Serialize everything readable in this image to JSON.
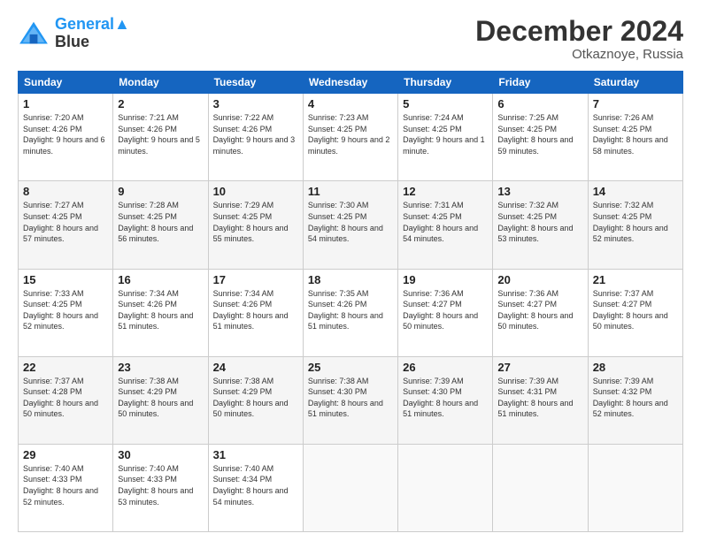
{
  "header": {
    "logo_line1": "General",
    "logo_line2": "Blue",
    "month": "December 2024",
    "location": "Otkaznoye, Russia"
  },
  "days_of_week": [
    "Sunday",
    "Monday",
    "Tuesday",
    "Wednesday",
    "Thursday",
    "Friday",
    "Saturday"
  ],
  "weeks": [
    [
      {
        "day": "1",
        "sunrise": "7:20 AM",
        "sunset": "4:26 PM",
        "daylight": "9 hours and 6 minutes."
      },
      {
        "day": "2",
        "sunrise": "7:21 AM",
        "sunset": "4:26 PM",
        "daylight": "9 hours and 5 minutes."
      },
      {
        "day": "3",
        "sunrise": "7:22 AM",
        "sunset": "4:26 PM",
        "daylight": "9 hours and 3 minutes."
      },
      {
        "day": "4",
        "sunrise": "7:23 AM",
        "sunset": "4:25 PM",
        "daylight": "9 hours and 2 minutes."
      },
      {
        "day": "5",
        "sunrise": "7:24 AM",
        "sunset": "4:25 PM",
        "daylight": "9 hours and 1 minute."
      },
      {
        "day": "6",
        "sunrise": "7:25 AM",
        "sunset": "4:25 PM",
        "daylight": "8 hours and 59 minutes."
      },
      {
        "day": "7",
        "sunrise": "7:26 AM",
        "sunset": "4:25 PM",
        "daylight": "8 hours and 58 minutes."
      }
    ],
    [
      {
        "day": "8",
        "sunrise": "7:27 AM",
        "sunset": "4:25 PM",
        "daylight": "8 hours and 57 minutes."
      },
      {
        "day": "9",
        "sunrise": "7:28 AM",
        "sunset": "4:25 PM",
        "daylight": "8 hours and 56 minutes."
      },
      {
        "day": "10",
        "sunrise": "7:29 AM",
        "sunset": "4:25 PM",
        "daylight": "8 hours and 55 minutes."
      },
      {
        "day": "11",
        "sunrise": "7:30 AM",
        "sunset": "4:25 PM",
        "daylight": "8 hours and 54 minutes."
      },
      {
        "day": "12",
        "sunrise": "7:31 AM",
        "sunset": "4:25 PM",
        "daylight": "8 hours and 54 minutes."
      },
      {
        "day": "13",
        "sunrise": "7:32 AM",
        "sunset": "4:25 PM",
        "daylight": "8 hours and 53 minutes."
      },
      {
        "day": "14",
        "sunrise": "7:32 AM",
        "sunset": "4:25 PM",
        "daylight": "8 hours and 52 minutes."
      }
    ],
    [
      {
        "day": "15",
        "sunrise": "7:33 AM",
        "sunset": "4:25 PM",
        "daylight": "8 hours and 52 minutes."
      },
      {
        "day": "16",
        "sunrise": "7:34 AM",
        "sunset": "4:26 PM",
        "daylight": "8 hours and 51 minutes."
      },
      {
        "day": "17",
        "sunrise": "7:34 AM",
        "sunset": "4:26 PM",
        "daylight": "8 hours and 51 minutes."
      },
      {
        "day": "18",
        "sunrise": "7:35 AM",
        "sunset": "4:26 PM",
        "daylight": "8 hours and 51 minutes."
      },
      {
        "day": "19",
        "sunrise": "7:36 AM",
        "sunset": "4:27 PM",
        "daylight": "8 hours and 50 minutes."
      },
      {
        "day": "20",
        "sunrise": "7:36 AM",
        "sunset": "4:27 PM",
        "daylight": "8 hours and 50 minutes."
      },
      {
        "day": "21",
        "sunrise": "7:37 AM",
        "sunset": "4:27 PM",
        "daylight": "8 hours and 50 minutes."
      }
    ],
    [
      {
        "day": "22",
        "sunrise": "7:37 AM",
        "sunset": "4:28 PM",
        "daylight": "8 hours and 50 minutes."
      },
      {
        "day": "23",
        "sunrise": "7:38 AM",
        "sunset": "4:29 PM",
        "daylight": "8 hours and 50 minutes."
      },
      {
        "day": "24",
        "sunrise": "7:38 AM",
        "sunset": "4:29 PM",
        "daylight": "8 hours and 50 minutes."
      },
      {
        "day": "25",
        "sunrise": "7:38 AM",
        "sunset": "4:30 PM",
        "daylight": "8 hours and 51 minutes."
      },
      {
        "day": "26",
        "sunrise": "7:39 AM",
        "sunset": "4:30 PM",
        "daylight": "8 hours and 51 minutes."
      },
      {
        "day": "27",
        "sunrise": "7:39 AM",
        "sunset": "4:31 PM",
        "daylight": "8 hours and 51 minutes."
      },
      {
        "day": "28",
        "sunrise": "7:39 AM",
        "sunset": "4:32 PM",
        "daylight": "8 hours and 52 minutes."
      }
    ],
    [
      {
        "day": "29",
        "sunrise": "7:40 AM",
        "sunset": "4:33 PM",
        "daylight": "8 hours and 52 minutes."
      },
      {
        "day": "30",
        "sunrise": "7:40 AM",
        "sunset": "4:33 PM",
        "daylight": "8 hours and 53 minutes."
      },
      {
        "day": "31",
        "sunrise": "7:40 AM",
        "sunset": "4:34 PM",
        "daylight": "8 hours and 54 minutes."
      },
      null,
      null,
      null,
      null
    ]
  ]
}
